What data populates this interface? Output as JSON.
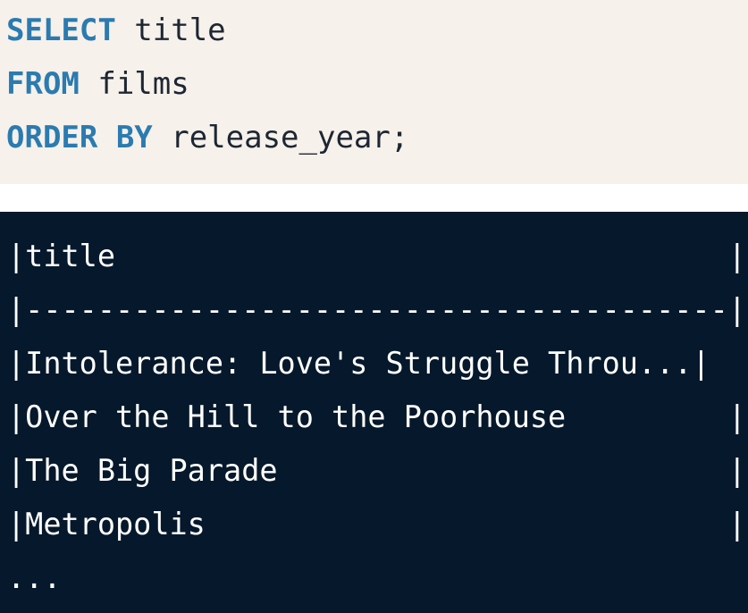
{
  "query": {
    "lines": [
      {
        "keyword": "SELECT",
        "rest": " title"
      },
      {
        "keyword": "FROM",
        "rest": " films"
      },
      {
        "keyword": "ORDER BY",
        "rest": " release_year;"
      }
    ]
  },
  "output": {
    "lines": [
      "|title                                  |",
      "|---------------------------------------|",
      "|Intolerance: Love's Struggle Throu...|",
      "|Over the Hill to the Poorhouse         |",
      "|The Big Parade                         |",
      "|Metropolis                             |",
      "..."
    ]
  },
  "colors": {
    "code_background": "#f6f1ea",
    "keyword": "#2b7bb0",
    "output_background": "#06182b",
    "output_text": "#ffffff"
  }
}
